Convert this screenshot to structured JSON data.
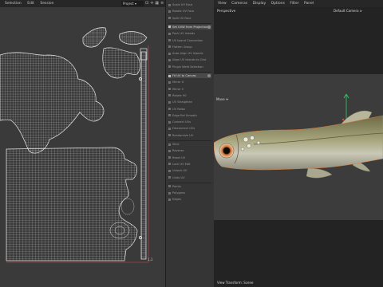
{
  "uv_editor": {
    "menu": [
      "Selection",
      "Edit",
      "Session"
    ],
    "mode_select": "Project",
    "corner_label": "1,1"
  },
  "tool_panel": {
    "items": [
      {
        "label": "Scale UV Face",
        "active": false
      },
      {
        "label": "Rotate UV Face",
        "active": false
      },
      {
        "label": "Split UV Face",
        "active": false
      },
      {
        "label": "Set UVW from Projection",
        "active": true
      },
      {
        "label": "Pack UV Islands",
        "active": false
      },
      {
        "label": "UV Island Connection",
        "active": false
      },
      {
        "label": "Flatten Group",
        "active": false
      },
      {
        "label": "Auto Align UV Islands",
        "active": false
      },
      {
        "label": "Align UV Islands to Grid",
        "active": false
      },
      {
        "label": "Plugin Weld Selection",
        "active": false
      },
      {
        "label": "Fit UV to Canvas",
        "active": true
      },
      {
        "label": "Mirror U",
        "active": false
      },
      {
        "label": "Mirror V",
        "active": false
      },
      {
        "label": "Rotate 90",
        "active": false
      },
      {
        "label": "UV Straighten",
        "active": false
      },
      {
        "label": "UV Relax",
        "active": false
      },
      {
        "label": "Edge Rel Smooth",
        "active": false
      },
      {
        "label": "Connect UVs",
        "active": false
      },
      {
        "label": "Disconnect UVs",
        "active": false
      },
      {
        "label": "Randomize UV",
        "active": false
      },
      {
        "label": "Slice",
        "active": false
      },
      {
        "label": "Reverse",
        "active": false
      },
      {
        "label": "Reset UV",
        "active": false
      },
      {
        "label": "Lock UV Edit",
        "active": false
      },
      {
        "label": "Unlock UV",
        "active": false
      },
      {
        "label": "Undo UV",
        "active": false
      },
      {
        "label": "Points",
        "active": false
      },
      {
        "label": "Polygons",
        "active": false
      },
      {
        "label": "Edges",
        "active": false
      }
    ]
  },
  "viewport": {
    "menu": [
      "View",
      "Cameras",
      "Display",
      "Options",
      "Filter",
      "Panel"
    ],
    "view_name": "Perspective",
    "camera": "Default Camera",
    "move_label": "Move",
    "status": "View Transform: Scene"
  },
  "colors": {
    "uv_background": "#3a3a3a",
    "wireframe": "#d8d8d8",
    "uv_border": "#e05050",
    "viewport_background": "#232323",
    "scene_floor": "#3c3c3c",
    "axis_green": "#2fd060",
    "axis_blue": "#3a70e0",
    "axis_red": "#e04040"
  }
}
